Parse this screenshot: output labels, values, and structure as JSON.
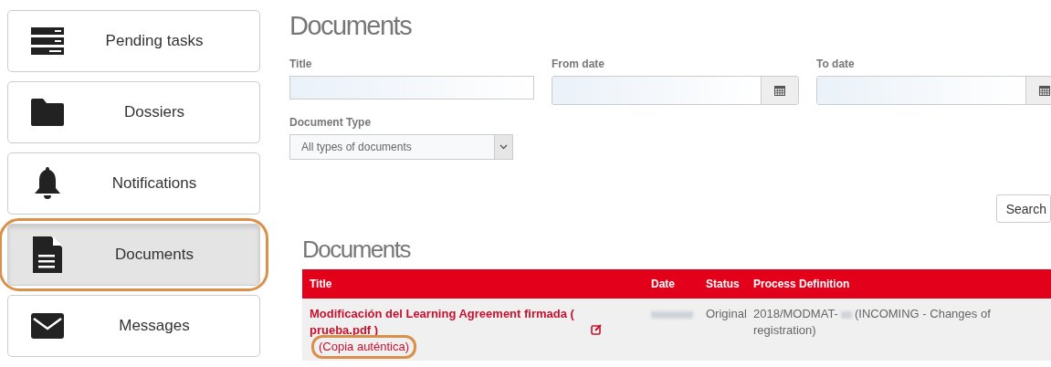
{
  "sidebar": {
    "items": [
      {
        "label": "Pending tasks",
        "selected": false
      },
      {
        "label": "Dossiers",
        "selected": false
      },
      {
        "label": "Notifications",
        "selected": false
      },
      {
        "label": "Documents",
        "selected": true
      },
      {
        "label": "Messages",
        "selected": false
      }
    ]
  },
  "heading": "Documents",
  "filters": {
    "title_label": "Title",
    "from_label": "From date",
    "to_label": "To date",
    "type_label": "Document Type",
    "type_value": "All types of documents",
    "search_button": "Search"
  },
  "results": {
    "heading": "Documents",
    "columns": [
      "Title",
      "Date",
      "Status",
      "Process Definition"
    ],
    "rows": [
      {
        "title": "Modificación del Learning Agreement firmada ( prueba.pdf )",
        "copy_link": "(Copia auténtica)",
        "status": "Original",
        "process_prefix": "2018/MODMAT-",
        "process_suffix": "(INCOMING - Changes of registration)"
      }
    ]
  }
}
